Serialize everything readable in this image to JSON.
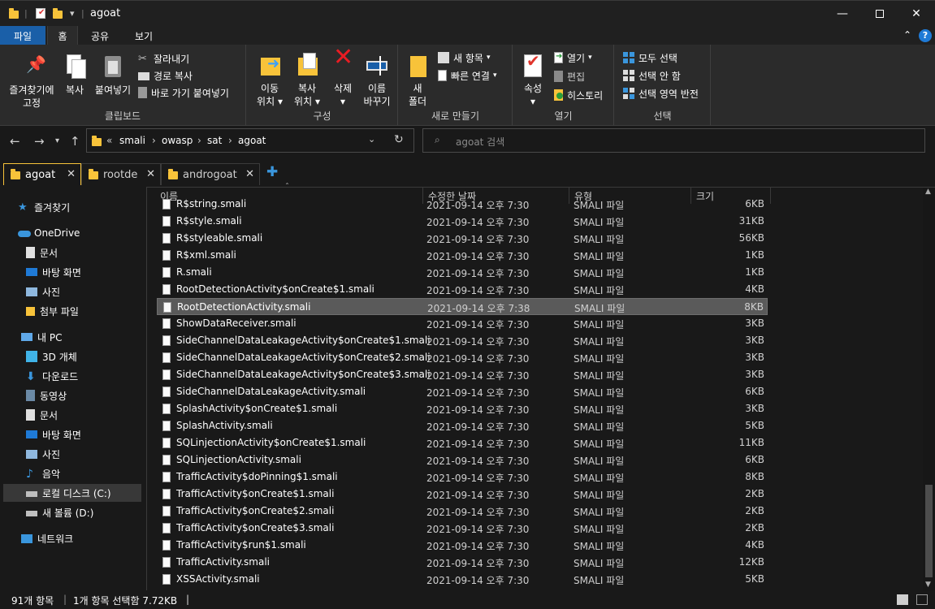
{
  "window": {
    "title": "agoat",
    "accent": "#1a5fa8"
  },
  "ribbon_tabs": [
    "파일",
    "홈",
    "공유",
    "보기"
  ],
  "ribbon": {
    "clipboard": {
      "pin": [
        "즐겨찾기에",
        "고정"
      ],
      "copy": "복사",
      "paste": "붙여넣기",
      "cut": "잘라내기",
      "copy_path": "경로 복사",
      "paste_shortcut": "바로 가기 붙여넣기",
      "label": "클립보드"
    },
    "organize": {
      "move": [
        "이동",
        "위치"
      ],
      "copyto": [
        "복사",
        "위치"
      ],
      "delete": "삭제",
      "rename": [
        "이름",
        "바꾸기"
      ],
      "label": "구성"
    },
    "new": {
      "folder": [
        "새",
        "폴더"
      ],
      "new_item": "새 항목",
      "easy_access": "빠른 연결",
      "label": "새로 만들기"
    },
    "open": {
      "properties": "속성",
      "open": "열기",
      "edit": "편집",
      "history": "히스토리",
      "label": "열기"
    },
    "select": {
      "all": "모두 선택",
      "none": "선택 안 함",
      "invert": "선택 영역 반전",
      "label": "선택"
    }
  },
  "address": {
    "crumbs": [
      "smali",
      "owasp",
      "sat",
      "agoat"
    ],
    "search_placeholder": "agoat 검색"
  },
  "explorer_tabs": [
    "agoat",
    "rootde",
    "androgoat"
  ],
  "nav": {
    "quick_access": "즐겨찾기",
    "onedrive": "OneDrive",
    "onedrive_items": [
      "문서",
      "바탕 화면",
      "사진",
      "첨부 파일"
    ],
    "this_pc": "내 PC",
    "pc_items": [
      "3D 개체",
      "다운로드",
      "동영상",
      "문서",
      "바탕 화면",
      "사진",
      "음악",
      "로컬 디스크 (C:)",
      "새 볼륨 (D:)"
    ],
    "network": "네트워크"
  },
  "columns": [
    "이름",
    "수정한 날짜",
    "유형",
    "크기"
  ],
  "files": [
    {
      "name": "R$string.smali",
      "date": "2021-09-14 오후 7:30",
      "type": "SMALI 파일",
      "size": "6KB"
    },
    {
      "name": "R$style.smali",
      "date": "2021-09-14 오후 7:30",
      "type": "SMALI 파일",
      "size": "31KB"
    },
    {
      "name": "R$styleable.smali",
      "date": "2021-09-14 오후 7:30",
      "type": "SMALI 파일",
      "size": "56KB"
    },
    {
      "name": "R$xml.smali",
      "date": "2021-09-14 오후 7:30",
      "type": "SMALI 파일",
      "size": "1KB"
    },
    {
      "name": "R.smali",
      "date": "2021-09-14 오후 7:30",
      "type": "SMALI 파일",
      "size": "1KB"
    },
    {
      "name": "RootDetectionActivity$onCreate$1.smali",
      "date": "2021-09-14 오후 7:30",
      "type": "SMALI 파일",
      "size": "4KB"
    },
    {
      "name": "RootDetectionActivity.smali",
      "date": "2021-09-14 오후 7:38",
      "type": "SMALI 파일",
      "size": "8KB",
      "selected": true
    },
    {
      "name": "ShowDataReceiver.smali",
      "date": "2021-09-14 오후 7:30",
      "type": "SMALI 파일",
      "size": "3KB"
    },
    {
      "name": "SideChannelDataLeakageActivity$onCreate$1.smali",
      "date": "2021-09-14 오후 7:30",
      "type": "SMALI 파일",
      "size": "3KB"
    },
    {
      "name": "SideChannelDataLeakageActivity$onCreate$2.smali",
      "date": "2021-09-14 오후 7:30",
      "type": "SMALI 파일",
      "size": "3KB"
    },
    {
      "name": "SideChannelDataLeakageActivity$onCreate$3.smali",
      "date": "2021-09-14 오후 7:30",
      "type": "SMALI 파일",
      "size": "3KB"
    },
    {
      "name": "SideChannelDataLeakageActivity.smali",
      "date": "2021-09-14 오후 7:30",
      "type": "SMALI 파일",
      "size": "6KB"
    },
    {
      "name": "SplashActivity$onCreate$1.smali",
      "date": "2021-09-14 오후 7:30",
      "type": "SMALI 파일",
      "size": "3KB"
    },
    {
      "name": "SplashActivity.smali",
      "date": "2021-09-14 오후 7:30",
      "type": "SMALI 파일",
      "size": "5KB"
    },
    {
      "name": "SQLinjectionActivity$onCreate$1.smali",
      "date": "2021-09-14 오후 7:30",
      "type": "SMALI 파일",
      "size": "11KB"
    },
    {
      "name": "SQLinjectionActivity.smali",
      "date": "2021-09-14 오후 7:30",
      "type": "SMALI 파일",
      "size": "6KB"
    },
    {
      "name": "TrafficActivity$doPinning$1.smali",
      "date": "2021-09-14 오후 7:30",
      "type": "SMALI 파일",
      "size": "8KB"
    },
    {
      "name": "TrafficActivity$onCreate$1.smali",
      "date": "2021-09-14 오후 7:30",
      "type": "SMALI 파일",
      "size": "2KB"
    },
    {
      "name": "TrafficActivity$onCreate$2.smali",
      "date": "2021-09-14 오후 7:30",
      "type": "SMALI 파일",
      "size": "2KB"
    },
    {
      "name": "TrafficActivity$onCreate$3.smali",
      "date": "2021-09-14 오후 7:30",
      "type": "SMALI 파일",
      "size": "2KB"
    },
    {
      "name": "TrafficActivity$run$1.smali",
      "date": "2021-09-14 오후 7:30",
      "type": "SMALI 파일",
      "size": "4KB"
    },
    {
      "name": "TrafficActivity.smali",
      "date": "2021-09-14 오후 7:30",
      "type": "SMALI 파일",
      "size": "12KB"
    },
    {
      "name": "XSSActivity.smali",
      "date": "2021-09-14 오후 7:30",
      "type": "SMALI 파일",
      "size": "5KB"
    }
  ],
  "status": {
    "count": "91개 항목",
    "selection": "1개 항목 선택함 7.72KB"
  }
}
